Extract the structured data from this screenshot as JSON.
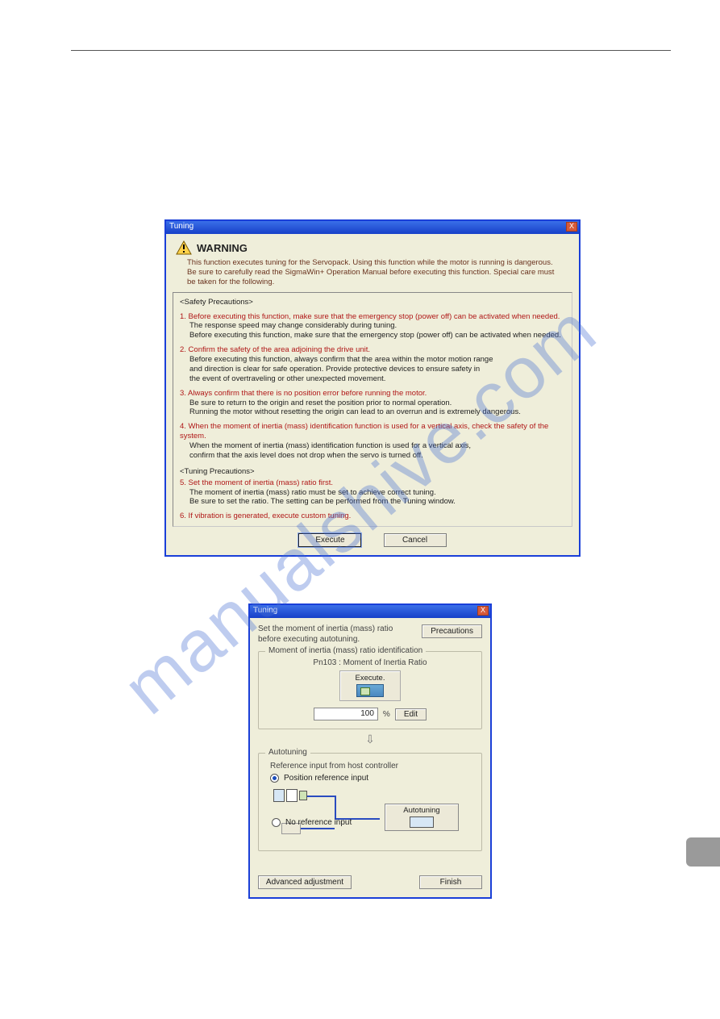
{
  "watermark": "manualshive.com",
  "dlg1": {
    "title": "Tuning",
    "warning_title": "WARNING",
    "blurb": "This function executes tuning for the Servopack. Using this function while the motor is running is dangerous. Be sure to carefully read the SigmaWin+ Operation Manual before executing this function. Special care must be taken for the following.",
    "safety_hdr": "<Safety Precautions>",
    "i1_red": "1. Before executing this function, make sure that the emergency stop (power off) can be activated when needed.",
    "i1_a": "The response speed may change considerably during tuning.",
    "i1_b": "Before executing this function, make sure that the emergency stop (power off) can be activated when needed.",
    "i2_red": "2. Confirm the safety of the area adjoining the drive unit.",
    "i2_a": "Before executing this function, always confirm that the area within the motor motion range",
    "i2_b": "and direction is clear for safe operation. Provide protective devices to ensure safety in",
    "i2_c": "the event of overtraveling or other unexpected movement.",
    "i3_red": "3. Always confirm that there is no position error before running the motor.",
    "i3_a": "Be sure to return to the origin and reset the position prior to normal operation.",
    "i3_b": "Running the motor without resetting the origin can lead to an overrun and is extremely dangerous.",
    "i4_red": "4. When the moment of inertia (mass) identification function is used for a vertical axis, check the safety of the system.",
    "i4_a": "When the moment of inertia (mass) identification function is used for a vertical axis,",
    "i4_b": "confirm that the axis level does not drop when the servo is turned off.",
    "tuning_hdr": "<Tuning Precautions>",
    "i5_red": "5. Set the moment of inertia (mass) ratio first.",
    "i5_a": "The moment of inertia (mass) ratio must be set to achieve correct tuning.",
    "i5_b": "Be sure to set the ratio. The setting can be performed from the Tuning window.",
    "i6_red": "6. If vibration is generated, execute custom tuning.",
    "btn_execute": "Execute",
    "btn_cancel": "Cancel",
    "close_x": "X"
  },
  "dlg2": {
    "title": "Tuning",
    "close_x": "X",
    "msg": "Set the moment of inertia (mass) ratio before executing autotuning.",
    "btn_precautions": "Precautions",
    "grp_inertia": "Moment of inertia (mass) ratio identification",
    "pn_label": "Pn103 : Moment of Inertia Ratio",
    "btn_exec": "Execute.",
    "ratio_value": "100",
    "ratio_unit": "%",
    "btn_edit": "Edit",
    "grp_auto": "Autotuning",
    "ref_label": "Reference input from host controller",
    "opt_pos": "Position reference input",
    "opt_noref": "No reference input",
    "btn_autotuning": "Autotuning",
    "btn_adv": "Advanced adjustment",
    "btn_finish": "Finish"
  }
}
